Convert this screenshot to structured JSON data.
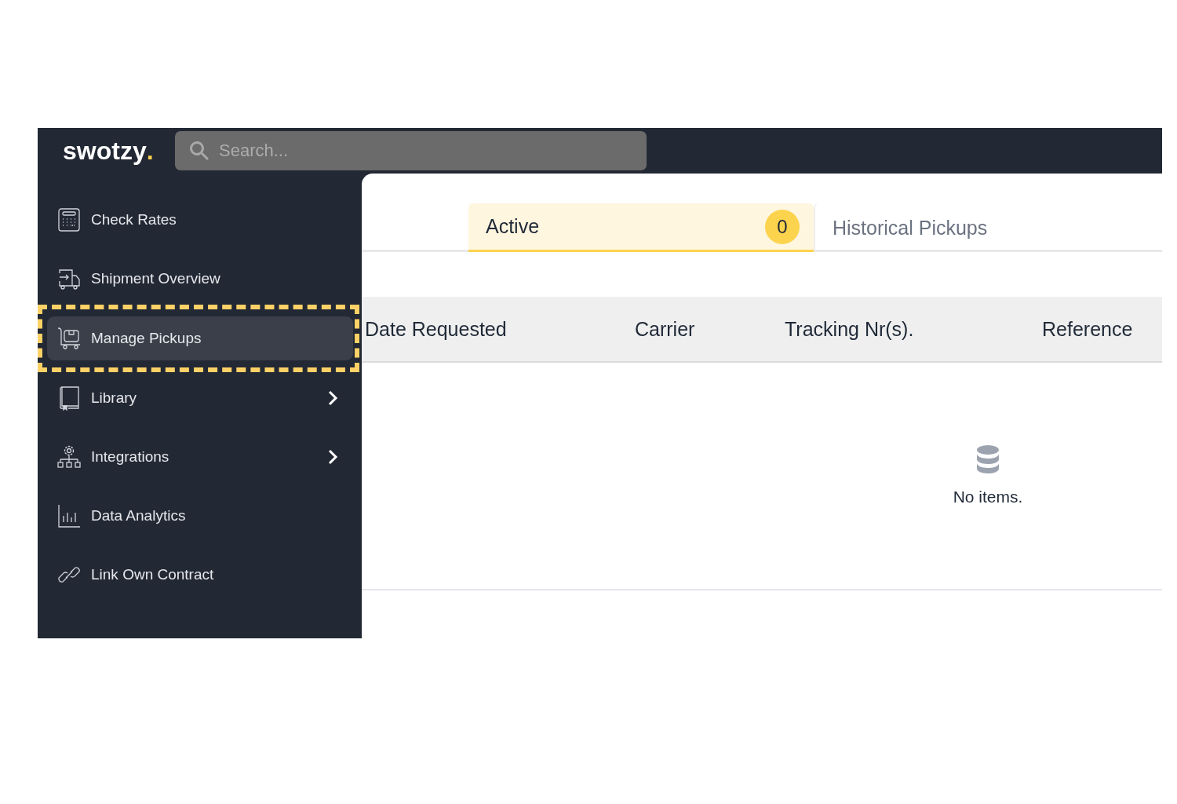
{
  "header": {
    "logo": {
      "text": "swotzy",
      "dot": "."
    },
    "search": {
      "placeholder": "Search..."
    }
  },
  "sidebar": {
    "items": [
      {
        "label": "Check Rates",
        "kind": "calculator",
        "selected": false,
        "highlighted": false,
        "expandable": false
      },
      {
        "label": "Shipment Overview",
        "kind": "truck",
        "selected": false,
        "highlighted": false,
        "expandable": false
      },
      {
        "label": "Manage Pickups",
        "kind": "cart",
        "selected": true,
        "highlighted": true,
        "expandable": false
      },
      {
        "label": "Library",
        "kind": "book",
        "selected": false,
        "highlighted": false,
        "expandable": true
      },
      {
        "label": "Integrations",
        "kind": "network",
        "selected": false,
        "highlighted": false,
        "expandable": true
      },
      {
        "label": "Data Analytics",
        "kind": "chart",
        "selected": false,
        "highlighted": false,
        "expandable": false
      },
      {
        "label": "Link Own Contract",
        "kind": "link",
        "selected": false,
        "highlighted": false,
        "expandable": false
      }
    ]
  },
  "tabs": [
    {
      "label": "Active",
      "count": "0",
      "selected": true
    },
    {
      "label": "Historical Pickups",
      "selected": false
    }
  ],
  "table": {
    "columns": [
      "Date Requested",
      "Carrier",
      "Tracking Nr(s).",
      "Reference"
    ],
    "empty_message": "No items."
  }
}
